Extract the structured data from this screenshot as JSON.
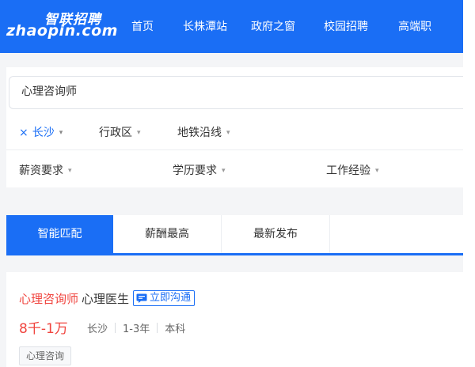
{
  "header": {
    "logo_cn": "智联招聘",
    "logo_en": "zhaopin.com",
    "nav": [
      "首页",
      "长株潭站",
      "政府之窗",
      "校园招聘",
      "高端职"
    ]
  },
  "search": {
    "value": "心理咨询师"
  },
  "filters": {
    "row1": [
      {
        "label": "长沙",
        "active": true,
        "clear_symbol": "×"
      },
      {
        "label": "行政区",
        "active": false
      },
      {
        "label": "地铁沿线",
        "active": false
      }
    ],
    "row2": [
      {
        "label": "薪资要求"
      },
      {
        "label": "学历要求"
      },
      {
        "label": "工作经验"
      }
    ],
    "caret_symbol": "▾"
  },
  "tabs": [
    {
      "label": "智能匹配",
      "active": true
    },
    {
      "label": "薪酬最高",
      "active": false
    },
    {
      "label": "最新发布",
      "active": false
    }
  ],
  "job": {
    "title": "心理咨询师",
    "subtitle": "心理医生",
    "chat_label": "立即沟通",
    "salary": "8千-1万",
    "meta": [
      "长沙",
      "1-3年",
      "本科"
    ],
    "tags": [
      "心理咨询"
    ]
  },
  "colors": {
    "brand_blue": "#1a6ef5",
    "accent_red": "#f0453f",
    "page_bg": "#f4f5f7"
  }
}
